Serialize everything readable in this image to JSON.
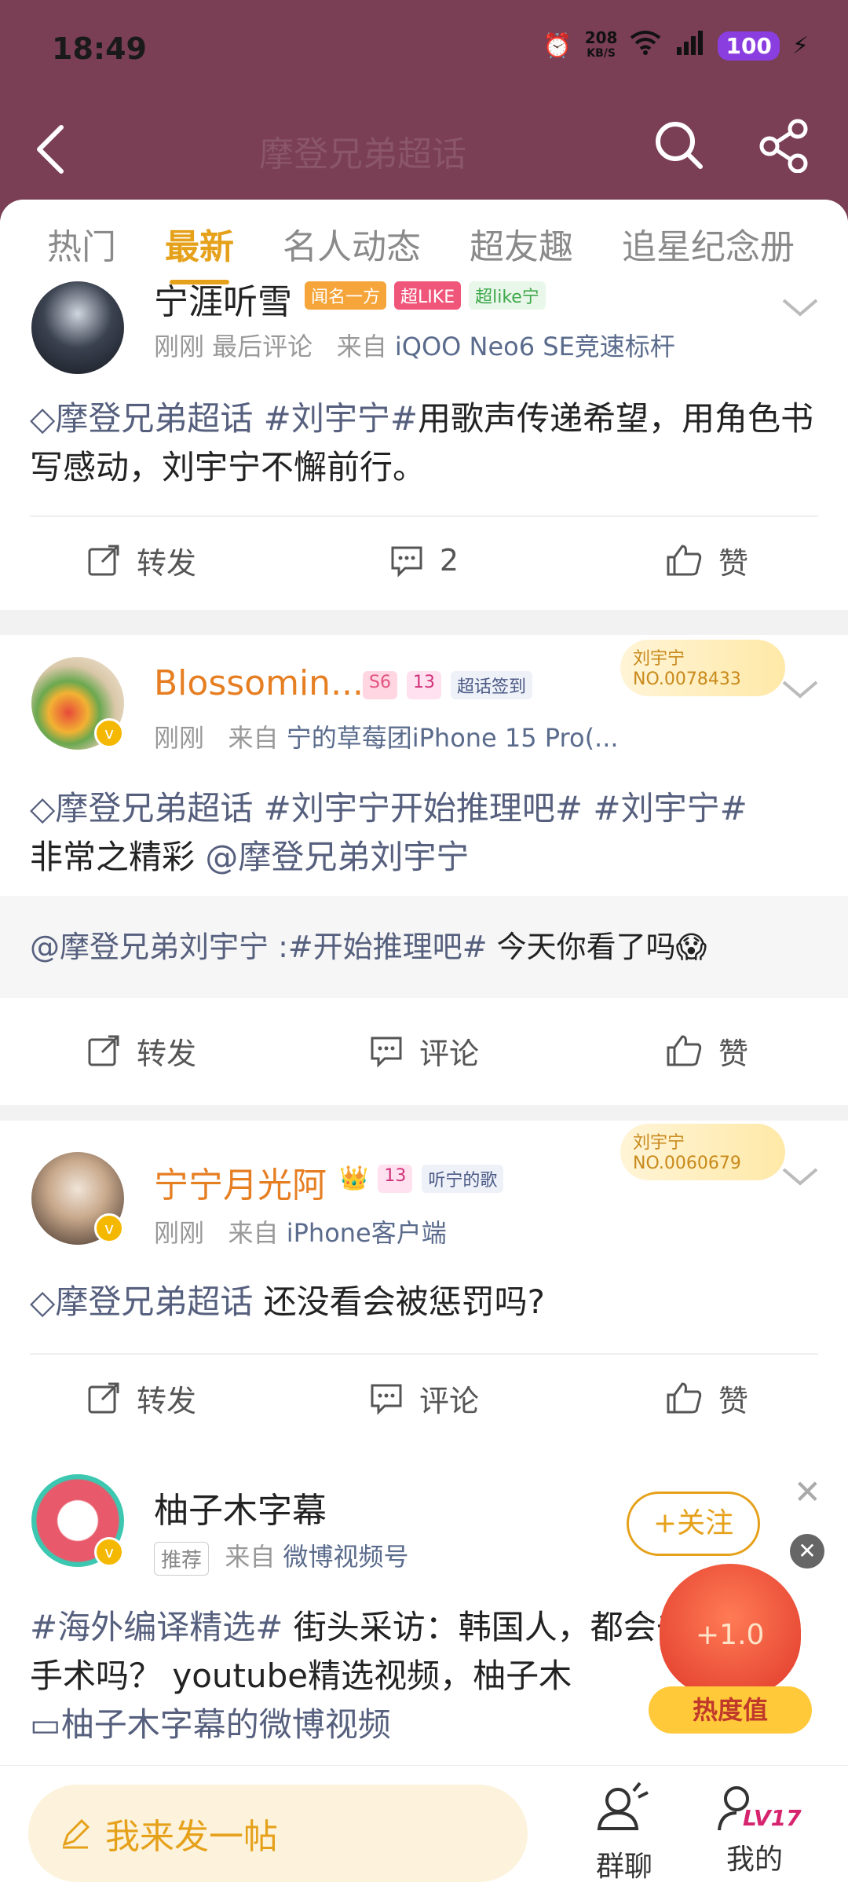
{
  "status": {
    "time": "18:49",
    "net_speed": "208",
    "net_unit": "KB/S",
    "battery": "100"
  },
  "header": {
    "title": "摩登兄弟超话"
  },
  "tabs": [
    {
      "label": "热门"
    },
    {
      "label": "最新"
    },
    {
      "label": "名人动态"
    },
    {
      "label": "超友趣"
    },
    {
      "label": "追星纪念册"
    }
  ],
  "posts": [
    {
      "user": "宁涯听雪",
      "badges": [
        "闻名一方",
        "超LIKE",
        "超like宁"
      ],
      "meta_time": "刚刚 最后评论",
      "meta_from": "来自",
      "meta_src": "iQOO Neo6 SE竞速标杆",
      "text_link": "摩登兄弟超话 #刘宇宁#",
      "text": "用歌声传递希望，用角色书写感动，刘宇宁不懈前行。",
      "repost": "转发",
      "comment": "2",
      "like": "赞"
    },
    {
      "user": "Blossomin...",
      "badges": [
        "S6",
        "13",
        "超话签到"
      ],
      "fan_name": "刘宇宁",
      "fan_no": "NO.0078433",
      "meta_time": "刚刚",
      "meta_from": "来自",
      "meta_src": "宁的草莓团iPhone 15 Pro(...",
      "text_link": "摩登兄弟超话  #刘宇宁开始推理吧# #刘宇宁#",
      "text": "非常之精彩 ",
      "text_mention": "@摩登兄弟刘宇宁",
      "quote_link": "@摩登兄弟刘宇宁 :#开始推理吧#",
      "quote_text": " 今天你看了吗😱",
      "repost": "转发",
      "comment": "评论",
      "like": "赞"
    },
    {
      "user": "宁宁月光阿",
      "badges": [
        "13",
        "听宁的歌"
      ],
      "fan_name": "刘宇宁",
      "fan_no": "NO.0060679",
      "meta_time": "刚刚",
      "meta_from": "来自",
      "meta_src": "iPhone客户端",
      "text_link": "摩登兄弟超话",
      "text": "  还没看会被惩罚吗?",
      "repost": "转发",
      "comment": "评论",
      "like": "赞"
    },
    {
      "user": "柚子木字幕",
      "tag": "推荐",
      "meta_from": "来自",
      "meta_src": "微博视频号",
      "follow": "+关注",
      "text_link": "#海外编译精选#",
      "text": " 街头采访：韩国人，都会去做整形手术吗？ youtube精选视频，柚子木",
      "video_link": "柚子木字幕的微博视频"
    }
  ],
  "hot_widget": {
    "value": "+1.0",
    "label": "热度值"
  },
  "bottom": {
    "compose": "我来发一帖",
    "chat": "群聊",
    "me": "我的",
    "level": "LV17"
  }
}
